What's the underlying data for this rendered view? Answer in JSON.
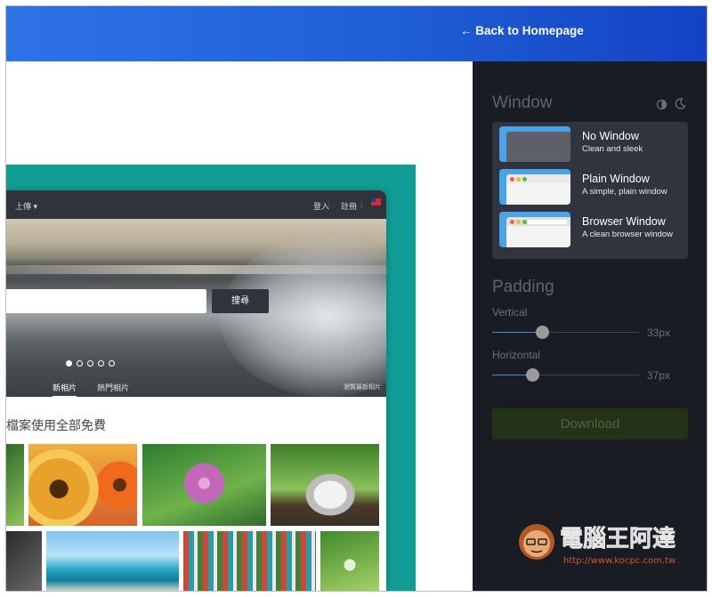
{
  "header": {
    "back_label": "← Back to Homepage"
  },
  "preview": {
    "nav": {
      "upload": "上傳 ▾",
      "login": "登入",
      "register": "註冊"
    },
    "search_button": "搜尋",
    "tabs": {
      "new": "新相片",
      "popular": "熱門相片",
      "more": "瀏覽最新相片"
    },
    "free_text": "檔案使用全部免費",
    "carousel": {
      "total": 5,
      "active": 1
    },
    "colors": {
      "frame_bg": "#119d96",
      "nav_bg": "#2f333b"
    }
  },
  "sidebar": {
    "window_heading": "Window",
    "options": [
      {
        "title": "No Window",
        "desc": "Clean and sleek"
      },
      {
        "title": "Plain Window",
        "desc": "A simple, plain window"
      },
      {
        "title": "Browser Window",
        "desc": "A clean browser window"
      }
    ],
    "padding_heading": "Padding",
    "vertical": {
      "label": "Vertical",
      "value": "33px",
      "fraction": 0.34
    },
    "horizontal": {
      "label": "Horizontal",
      "value": "37px",
      "fraction": 0.27
    },
    "download_label": "Download",
    "colors": {
      "panel_bg": "#191c22",
      "accent": "#4aa3e6",
      "download_bg": "#223318"
    }
  },
  "watermark": {
    "text": "電腦王阿達",
    "url": "http://www.kocpc.com.tw"
  }
}
